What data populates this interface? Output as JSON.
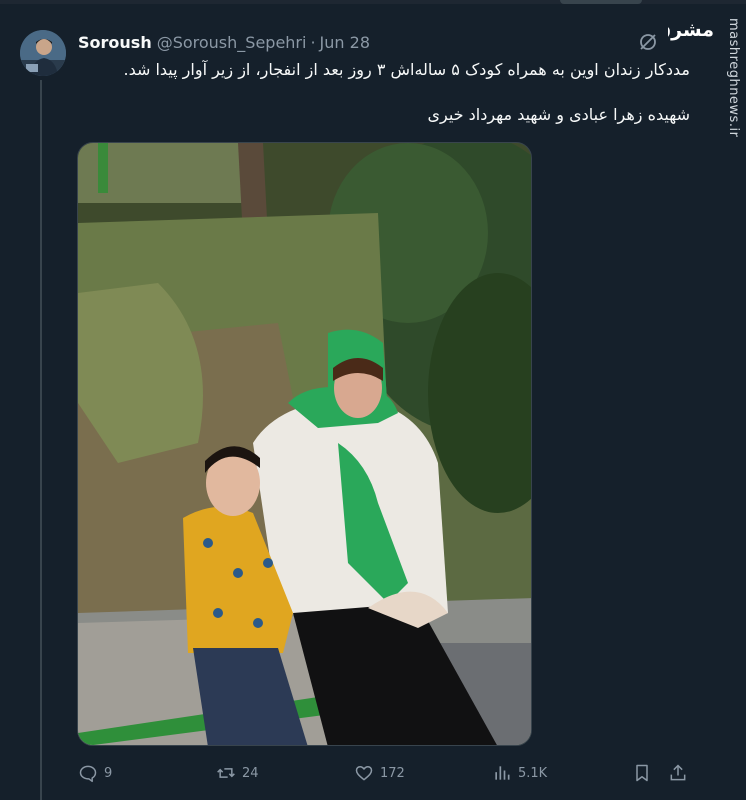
{
  "tweet": {
    "author_name": "Soroush",
    "author_handle": "@Soroush_Sepehri",
    "separator": "·",
    "date": "Jun 28",
    "text_line1": "مددکار زندان اوین به همراه کودک ۵ ساله‌اش ۳ روز بعد از انفجار، از زیر آوار پیدا شد.",
    "text_line2": "شهیده زهرا عبادی و شهید مهرداد خیری"
  },
  "watermark": {
    "site": "mashreghnews.ir",
    "logo_text": "مشرق"
  },
  "actions": {
    "replies": "9",
    "reposts": "24",
    "likes": "172",
    "views": "5.1K"
  },
  "colors": {
    "background": "#15202b",
    "text_primary": "#f7f9f9",
    "text_secondary": "#8b98a5",
    "border": "#38444d"
  }
}
